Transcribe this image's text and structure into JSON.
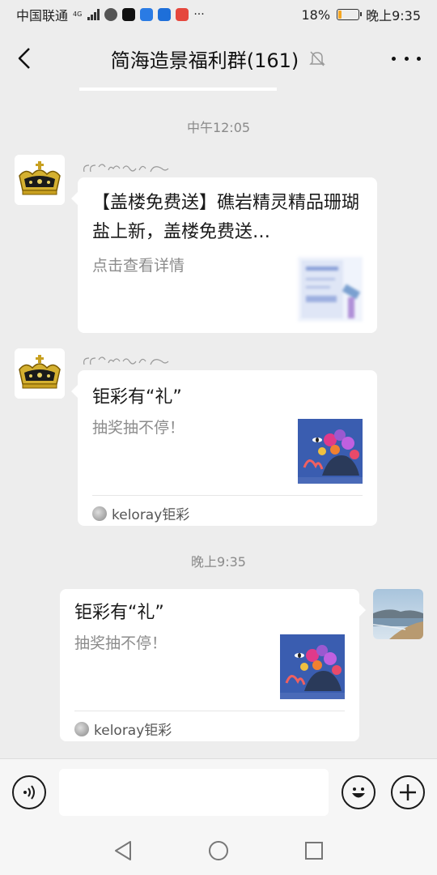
{
  "status_bar": {
    "carrier": "中国联通",
    "network": "4G",
    "battery_percent": "18%",
    "battery_level": 0.18,
    "time": "晚上9:35"
  },
  "nav": {
    "title": "简海造景福利群(161)",
    "muted": true,
    "icons": {
      "back": "back-arrow-icon",
      "more": "more-icon",
      "mute": "bell-off-icon"
    }
  },
  "messages": [
    {
      "timestamp": "中午12:05",
      "title": "【盖楼免费送】礁岩精灵精品珊瑚盐上新，盖楼免费送…",
      "desc": "点击查看详情"
    },
    {
      "title": "钜彩有“礼”",
      "desc": "抽奖抽不停！",
      "source": "keloray钜彩"
    },
    {
      "timestamp": "晚上9:35",
      "title": "钜彩有“礼”",
      "desc": "抽奖抽不停！",
      "source": "keloray钜彩"
    }
  ],
  "input_bar": {
    "placeholder": "",
    "icons": {
      "voice": "voice-icon",
      "emoji": "emoji-icon",
      "add": "plus-icon"
    }
  },
  "system_nav": {
    "icons": {
      "back": "nav-back-icon",
      "home": "nav-home-icon",
      "recents": "nav-recents-icon"
    }
  },
  "colors": {
    "background": "#ededed",
    "bubble": "#ffffff",
    "battery": "#f5a623",
    "muted_text": "#8c8c8c"
  }
}
